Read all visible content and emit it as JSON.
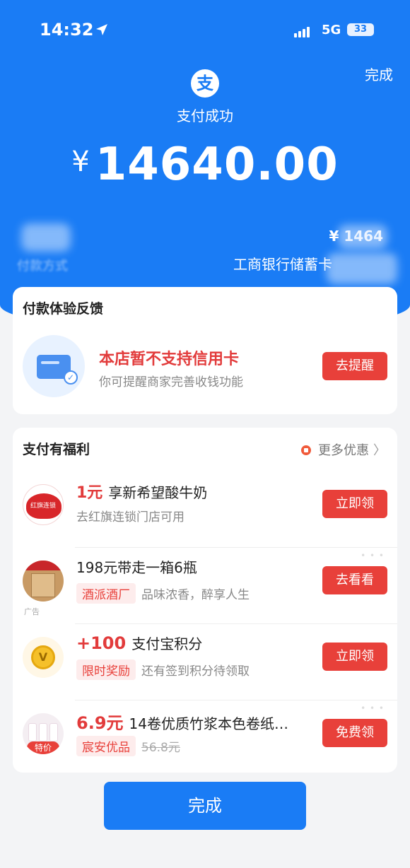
{
  "status_bar": {
    "time": "14:32",
    "network": "5G",
    "battery": "33"
  },
  "header": {
    "done_label": "完成",
    "logo_char": "支",
    "title": "支付成功"
  },
  "payment": {
    "currency": "¥",
    "amount": "14640.00",
    "method_label": "付款方式",
    "method_amount": "¥ 1464",
    "bank": "工商银行储蓄卡"
  },
  "feedback": {
    "title": "付款体验反馈",
    "main_text": "本店暂不支持信用卡",
    "sub_text": "你可提醒商家完善收钱功能",
    "button": "去提醒"
  },
  "benefits": {
    "title": "支付有福利",
    "more_label": "更多优惠",
    "items": [
      {
        "highlight": "1元",
        "title": "享新希望酸牛奶",
        "badge": "",
        "sub": "去红旗连锁门店可用",
        "button": "立即领",
        "thumb_text": "红旗连锁"
      },
      {
        "highlight": "",
        "title": "198元带走一箱6瓶",
        "badge": "酒派酒厂",
        "sub": "品味浓香，醉享人生",
        "button": "去看看",
        "ad": "广告"
      },
      {
        "highlight": "+100",
        "title": "支付宝积分",
        "badge": "限时奖励",
        "sub": "还有签到积分待领取",
        "button": "立即领",
        "thumb_text": "V"
      },
      {
        "highlight": "6.9元",
        "title": "14卷优质竹浆本色卷纸…",
        "badge": "宸安优品",
        "sub": "56.8元",
        "button": "免费领",
        "thumb_text": "特价"
      }
    ]
  },
  "footer": {
    "done_button": "完成"
  }
}
